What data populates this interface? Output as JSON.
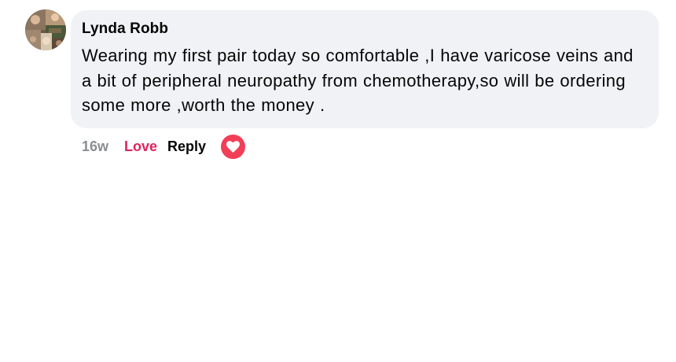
{
  "comment": {
    "author": "Lynda Robb",
    "text": "Wearing my first pair today so comfortable ,I have varicose veins and a bit of peripheral neuropathy from chemotherapy,so will be ordering some more ,worth the money .",
    "timestamp": "16w",
    "actions": {
      "love_label": "Love",
      "reply_label": "Reply"
    },
    "reaction_icon": "heart-icon",
    "colors": {
      "bubble": "#f0f2f5",
      "love": "#e0245e",
      "reaction_badge": "#f33e58",
      "timestamp": "#8a8d91"
    }
  }
}
